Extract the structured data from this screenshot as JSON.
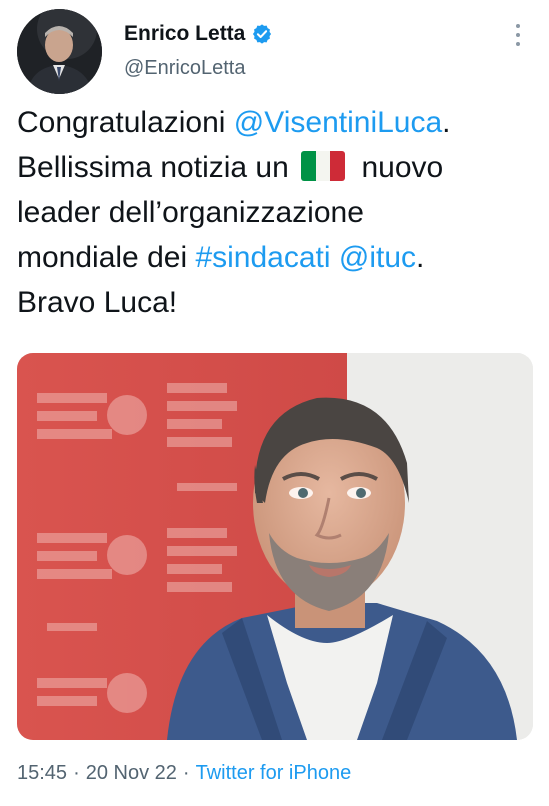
{
  "author": {
    "display_name": "Enrico Letta",
    "handle": "@EnricoLetta",
    "verified_icon": "verified-badge-icon",
    "avatar": "profile-photo"
  },
  "tweet": {
    "line1": {
      "text": "Congratulazioni ",
      "mention": "@VisentiniLuca",
      "end": "."
    },
    "line2": {
      "text_before": "Bellissima notizia un ",
      "emoji": "italy-flag-emoji",
      "text_after": " nuovo"
    },
    "line3": {
      "text": "leader dell’organizzazione"
    },
    "line4": {
      "text": "mondiale dei ",
      "hashtag": "#sindacati",
      "space": " ",
      "mention": "@ituc",
      "end": "."
    },
    "line5": {
      "text": "Bravo Luca!"
    }
  },
  "media": {
    "type": "photo",
    "description_icon": "portrait-photo"
  },
  "meta": {
    "time": "15:45",
    "separator1": "·",
    "date": "20 Nov 22",
    "separator2": "·",
    "source": "Twitter for iPhone"
  },
  "colors": {
    "link": "#1d9bf0",
    "text": "#0f1419",
    "secondary": "#536471"
  }
}
